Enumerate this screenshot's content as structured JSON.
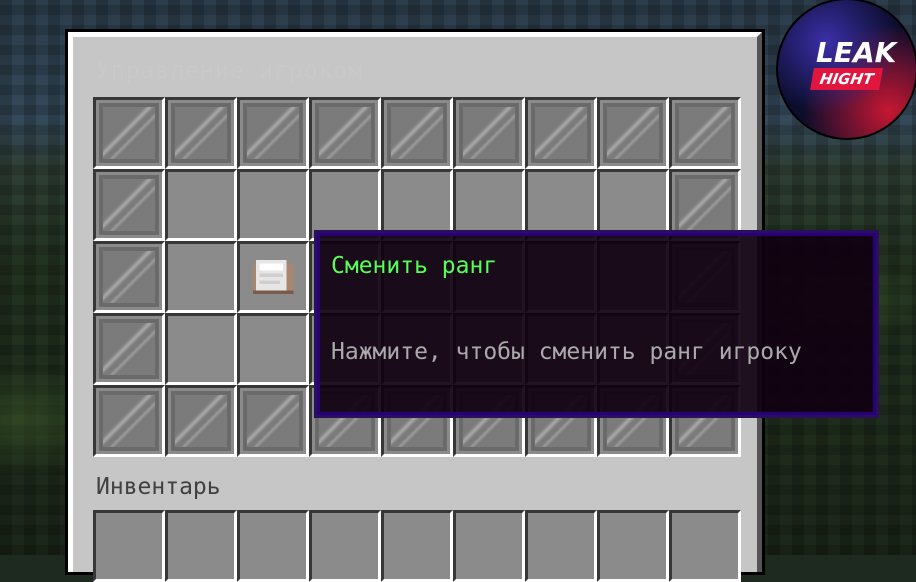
{
  "gui": {
    "title": "Управление игроком",
    "inventory_label": "Инвентарь"
  },
  "tooltip": {
    "title": "Сменить ранг",
    "description": "Нажмите, чтобы сменить ранг игроку",
    "title_color": "#55ff55",
    "description_color": "#aaaaaa"
  },
  "logo": {
    "top_text": "LEAK",
    "bottom_text": "HIGHT"
  },
  "slots": {
    "rows": [
      [
        "pane",
        "pane",
        "pane",
        "pane",
        "pane",
        "pane",
        "pane",
        "pane",
        "pane"
      ],
      [
        "pane",
        "empty",
        "empty",
        "empty",
        "empty",
        "empty",
        "empty",
        "empty",
        "pane"
      ],
      [
        "pane",
        "empty",
        "paper",
        "empty",
        "empty",
        "empty",
        "empty",
        "empty",
        "pane"
      ],
      [
        "pane",
        "empty",
        "empty",
        "empty",
        "empty",
        "empty",
        "empty",
        "empty",
        "pane"
      ],
      [
        "pane",
        "pane",
        "pane",
        "pane",
        "pane",
        "pane",
        "pane",
        "pane",
        "pane"
      ]
    ],
    "inventory_row": [
      "empty",
      "empty",
      "empty",
      "empty",
      "empty",
      "empty",
      "empty",
      "empty",
      "empty"
    ]
  }
}
